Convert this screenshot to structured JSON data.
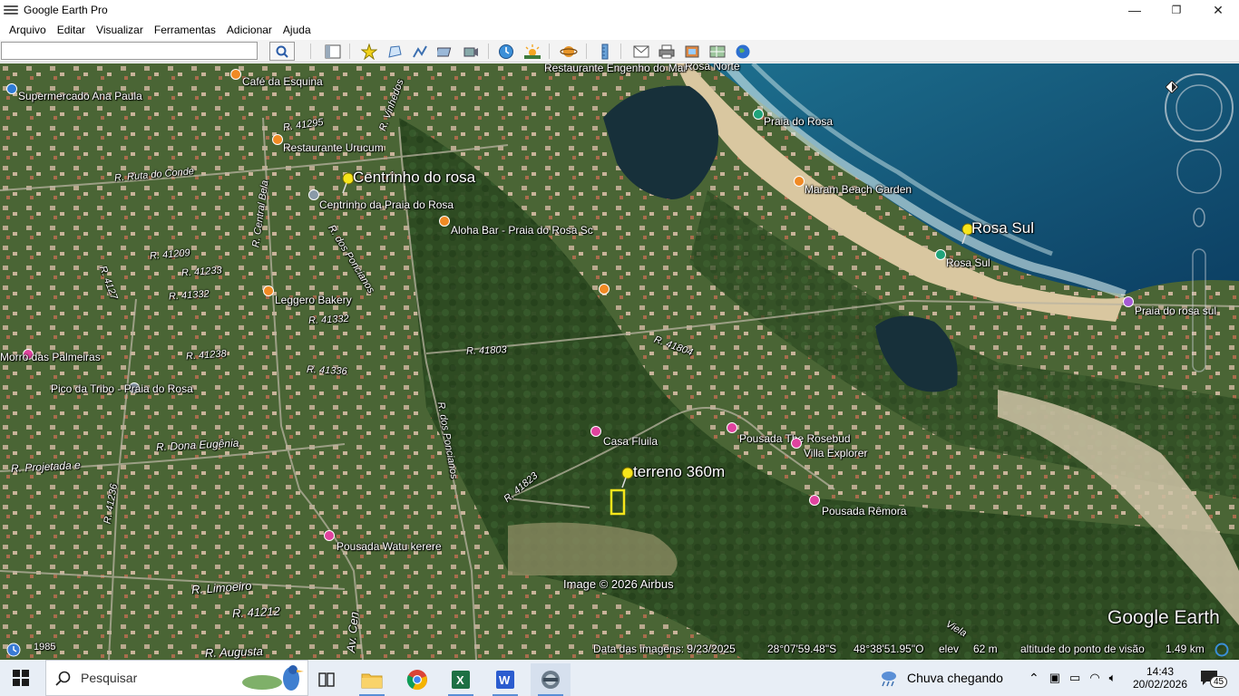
{
  "window": {
    "title": "Google Earth Pro",
    "minimize": "—",
    "maximize": "❐",
    "close": "✕"
  },
  "menu": [
    "Arquivo",
    "Editar",
    "Visualizar",
    "Ferramentas",
    "Adicionar",
    "Ajuda"
  ],
  "search": {
    "value": "",
    "placeholder": ""
  },
  "map": {
    "labels": {
      "restaurante_engenho": "Restaurante Engenho do Mar",
      "rosa_norte": "Rosa Norte",
      "supermercado": "Supermercado Ana Paula",
      "cafe_esquina": "Café da Esquina",
      "praia_do_rosa": "Praia do Rosa",
      "restaurante_urucum": "Restaurante Urucum",
      "centrinho_pin": "Centrinho do rosa",
      "centrinho_praia": "Centrinho da Praia do Rosa",
      "maram": "Maram Beach Garden",
      "aloha": "Aloha Bar - Praia do Rosa Sc",
      "rosa_sul_pin": "Rosa Sul",
      "rosa_sul": "Rosa Sul",
      "praia_rosa_sul": "Praia do rosa sul",
      "leggero": "Leggero Bakery",
      "morro_palmeiras": "Morro das Palmeiras",
      "pico_tribo": "Pico da Tribo - Praia do Rosa",
      "casa_fluila": "Casa Fluila",
      "pousada_rosebud": "Pousada The Rosebud",
      "villa_explorer": "Villa Explorer",
      "terreno_pin": "terreno 360m",
      "pousada_remora": "Pousada Rêmora",
      "pousada_watu": "Pousada Watu kerere",
      "image_credit": "Image © 2026 Airbus",
      "google_earth": "Google Earth"
    },
    "roads": {
      "r41295": "R. 41295",
      "r_ruta_conde": "R. Ruta do Conde",
      "r41209": "R. 41209",
      "r41233": "R. 41233",
      "r41332a": "R. 41332",
      "r41332b": "R. 41332",
      "r41238": "R. 41238",
      "r41336": "R. 41336",
      "r41803": "R. 41803",
      "r41804": "R. 41804",
      "r41823": "R. 41823",
      "r_dona_eugenia": "R. Dona Eugênia",
      "r_projetada": "R. Projetada e",
      "r41236": "R. 41236",
      "r_limoeiro": "R. Limoeiro",
      "r41212": "R. 41212",
      "r_augusta": "R. Augusta",
      "r_poncianos_a": "R. dos Poncianos",
      "r_poncianos_b": "R. dos Poncianos",
      "r_central": "R. Central Bela",
      "av_cen": "Av. Cen",
      "r41272": "R. 4127",
      "r_viela": "Viela",
      "r_vinhedos": "R. Vinhedos"
    }
  },
  "status": {
    "year": "1985",
    "date": "Data das imagens: 9/23/2025",
    "lat": "28°07'59.48\"S",
    "lon": "48°38'51.95\"O",
    "elev_label": "elev",
    "elev_value": "62 m",
    "eye_label": "altitude do ponto de visão",
    "eye_value": "1.49 km"
  },
  "taskbar": {
    "search_placeholder": "Pesquisar",
    "weather": "Chuva chegando",
    "time": "14:43",
    "date": "20/02/2026",
    "notifications": "45"
  },
  "colors": {
    "excel": "#1d7044",
    "word": "#2b5ccf",
    "chrome_red": "#db4437",
    "folder": "#f4c14a",
    "pin_yellow": "#f6e51b"
  }
}
